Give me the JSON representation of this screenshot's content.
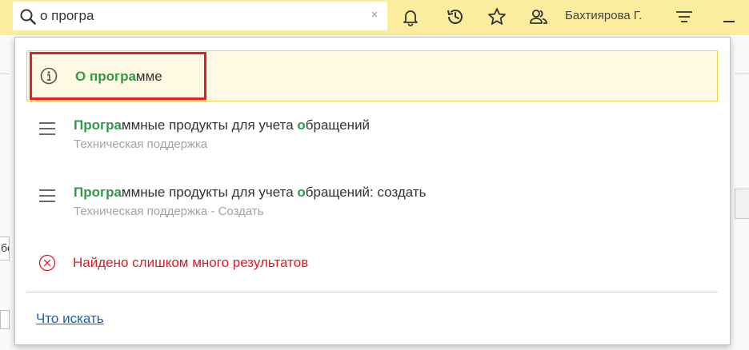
{
  "search": {
    "value": "о програ",
    "clear_symbol": "×"
  },
  "user": {
    "name": "Бахтиярова Г."
  },
  "background": {
    "left_field_text": "бо"
  },
  "results": [
    {
      "title_match": "О програ",
      "title_rest": "мме",
      "icon": "info-icon"
    },
    {
      "title_match": "Програ",
      "title_mid": "ммные продукты для учета ",
      "title_match2": "о",
      "title_rest": "бращений",
      "subtitle": "Техническая поддержка",
      "icon": "menu-lines-icon"
    },
    {
      "title_match": "Програ",
      "title_mid": "ммные продукты для учета ",
      "title_match2": "о",
      "title_rest": "бращений: создать",
      "subtitle": "Техническая поддержка - Создать",
      "icon": "menu-lines-icon"
    }
  ],
  "too_many": {
    "text": "Найдено слишком много результатов",
    "icon": "error-circle-icon"
  },
  "help": {
    "label": "Что искать"
  },
  "colors": {
    "topbar": "#fbed9e",
    "match_green": "#2e9b45",
    "error_red": "#e01b22",
    "highlight_frame": "#e31e24",
    "link_blue": "#1b5fb8"
  }
}
